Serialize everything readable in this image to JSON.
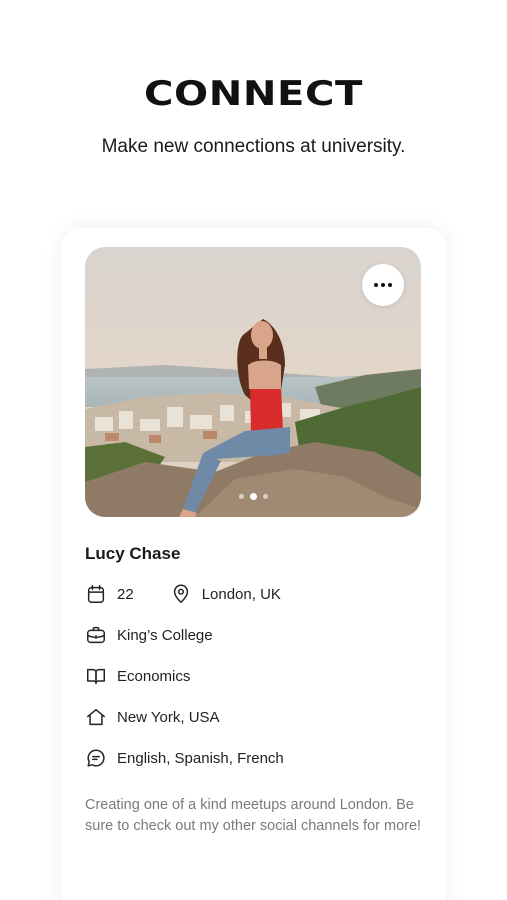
{
  "header": {
    "title": "CONNECT",
    "subtitle": "Make new connections at university."
  },
  "profile": {
    "name": "Lucy Chase",
    "age": "22",
    "location": "London, UK",
    "university": "King’s College",
    "course": "Economics",
    "hometown": "New York, USA",
    "languages": "English, Spanish, French",
    "bio": "Creating one of a kind meetups around London. Be sure to check out my other social channels for more!",
    "photo_count": 3,
    "active_photo": 2
  },
  "icons": {
    "more": "more-horizontal-icon",
    "age": "calendar-icon",
    "location": "map-pin-icon",
    "university": "briefcase-icon",
    "course": "book-icon",
    "hometown": "home-icon",
    "languages": "chat-bubble-icon"
  },
  "colors": {
    "background": "#ffffff",
    "text": "#1a1a1a",
    "bio_text": "#7a7a7a"
  }
}
